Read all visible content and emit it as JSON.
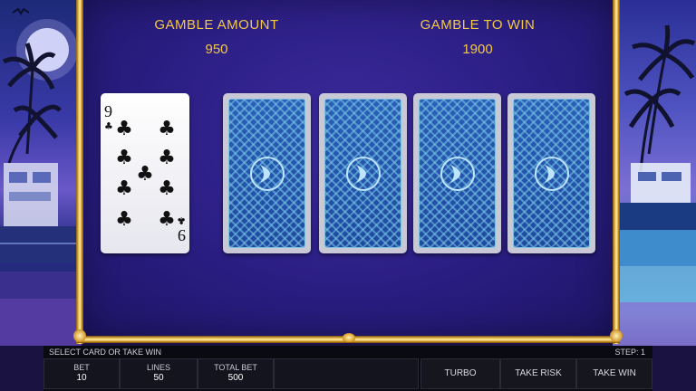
{
  "gamble": {
    "amount_label": "GAMBLE AMOUNT",
    "amount_value": "950",
    "to_win_label": "GAMBLE TO WIN",
    "to_win_value": "1900"
  },
  "cards": {
    "dealer_card": {
      "rank": "9",
      "suit": "clubs",
      "suit_glyph": "♣",
      "rotated_rank": "9"
    },
    "face_down_count": 4
  },
  "status": {
    "message": "SELECT CARD OR TAKE WIN",
    "step": "STEP: 1"
  },
  "controls": {
    "bet_label": "BET",
    "bet_value": "10",
    "lines_label": "LINES",
    "lines_value": "50",
    "total_bet_label": "TOTAL BET",
    "total_bet_value": "500",
    "turbo_label": "TURBO",
    "take_risk_label": "TAKE RISK",
    "take_win_label": "TAKE WIN"
  },
  "colors": {
    "gold_text": "#f2c84b",
    "card_back": "#2a5fb8",
    "turbo_indicator": "#e0242a"
  }
}
